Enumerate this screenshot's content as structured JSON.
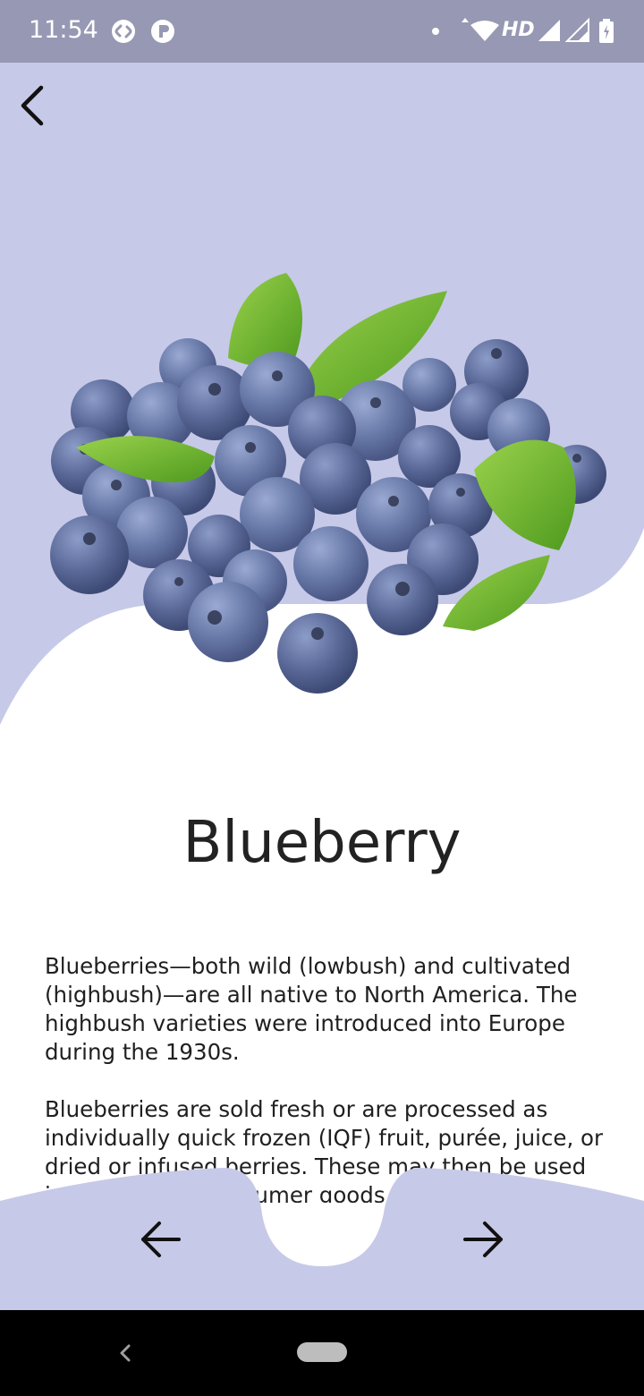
{
  "status_bar": {
    "time": "11:54",
    "network_label": "HD",
    "icons": [
      "shazam-icon",
      "app-p-icon",
      "dot-icon",
      "wifi-icon",
      "signal-icon",
      "signal-icon",
      "battery-icon"
    ]
  },
  "header": {
    "back_icon": "chevron-left-icon"
  },
  "fruit": {
    "name": "Blueberry",
    "image": "blueberries-with-leaves",
    "description_paragraphs": [
      "Blueberries—both wild (lowbush) and cultivated (highbush)—are all native to North America. The highbush varieties were introduced into Europe during the 1930s.",
      "Blueberries are sold fresh or are processed as individually quick frozen (IQF) fruit, purée, juice, or dried or infused berries. These may then be used in a variety of consumer goods, such as jellies, jams, pies, muffins, snack foods, and cereals."
    ]
  },
  "bottom_nav": {
    "prev_icon": "arrow-left-icon",
    "next_icon": "arrow-right-icon"
  },
  "colors": {
    "accent": "#c7c9e8",
    "status_bar": "#9798b3",
    "berry": "#5b6a98",
    "leaf": "#7cc230"
  }
}
